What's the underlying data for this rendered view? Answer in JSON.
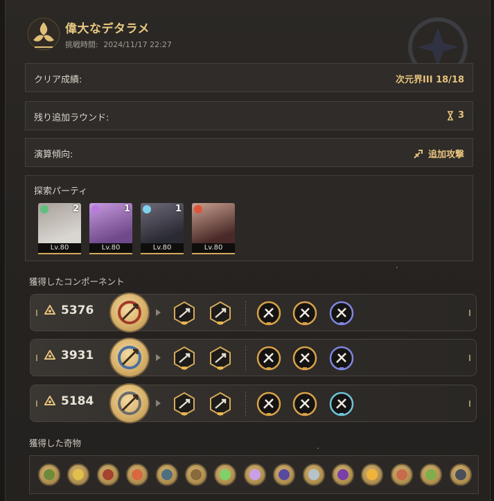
{
  "header": {
    "title": "偉大なデタラメ",
    "challenge_label": "挑戦時間:",
    "challenge_time": "2024/11/17 22:27"
  },
  "summary": {
    "clear_label": "クリア成績:",
    "clear_value": "次元界III 18/18",
    "rounds_label": "残り追加ラウンド:",
    "rounds_value": "3",
    "tendency_label": "演算傾向:",
    "tendency_value": "追加攻撃"
  },
  "party": {
    "label": "探索パーティ",
    "members": [
      {
        "level": "Lv.80",
        "rank": "2",
        "element_color": "#5fbf7f",
        "portrait_colors": [
          "#d9d5d0",
          "#a8a09a"
        ]
      },
      {
        "level": "Lv.80",
        "rank": "1",
        "element_color": "#b77be0",
        "portrait_colors": [
          "#6f4a8a",
          "#c79adf"
        ]
      },
      {
        "level": "Lv.80",
        "rank": "1",
        "element_color": "#7fd3ef",
        "portrait_colors": [
          "#2a2a33",
          "#6e6a78"
        ]
      },
      {
        "level": "Lv.80",
        "rank": "",
        "element_color": "#e0533b",
        "portrait_colors": [
          "#4a2a28",
          "#c9a090"
        ]
      }
    ]
  },
  "components": {
    "label": "獲得したコンポーネント",
    "rows": [
      {
        "score": "5376",
        "path_color": "#a33b28",
        "curio_rims": [
          "#d9a248",
          "#d9a248",
          "#7f86e0"
        ]
      },
      {
        "score": "3931",
        "path_color": "#4a6fa3",
        "curio_rims": [
          "#d9a248",
          "#d9a248",
          "#7f86e0"
        ]
      },
      {
        "score": "5184",
        "path_color": "#6b6b6b",
        "curio_rims": [
          "#d9a248",
          "#d9a248",
          "#6fc4d8"
        ]
      }
    ]
  },
  "curios": {
    "label": "獲得した奇物",
    "items": [
      {
        "inner": "#6f8a3a"
      },
      {
        "inner": "#e0c04a"
      },
      {
        "inner": "#a5432f"
      },
      {
        "inner": "#d9673f"
      },
      {
        "inner": "#4f6f7f"
      },
      {
        "inner": "#8a6a3a"
      },
      {
        "inner": "#7fd16a"
      },
      {
        "inner": "#c99fe8"
      },
      {
        "inner": "#5a4a9f"
      },
      {
        "inner": "#b7c3c9"
      },
      {
        "inner": "#7a3fa8"
      },
      {
        "inner": "#f0b33a"
      },
      {
        "inner": "#c96a4a"
      },
      {
        "inner": "#7fae4a"
      },
      {
        "inner": "#4a4f5a"
      }
    ]
  }
}
